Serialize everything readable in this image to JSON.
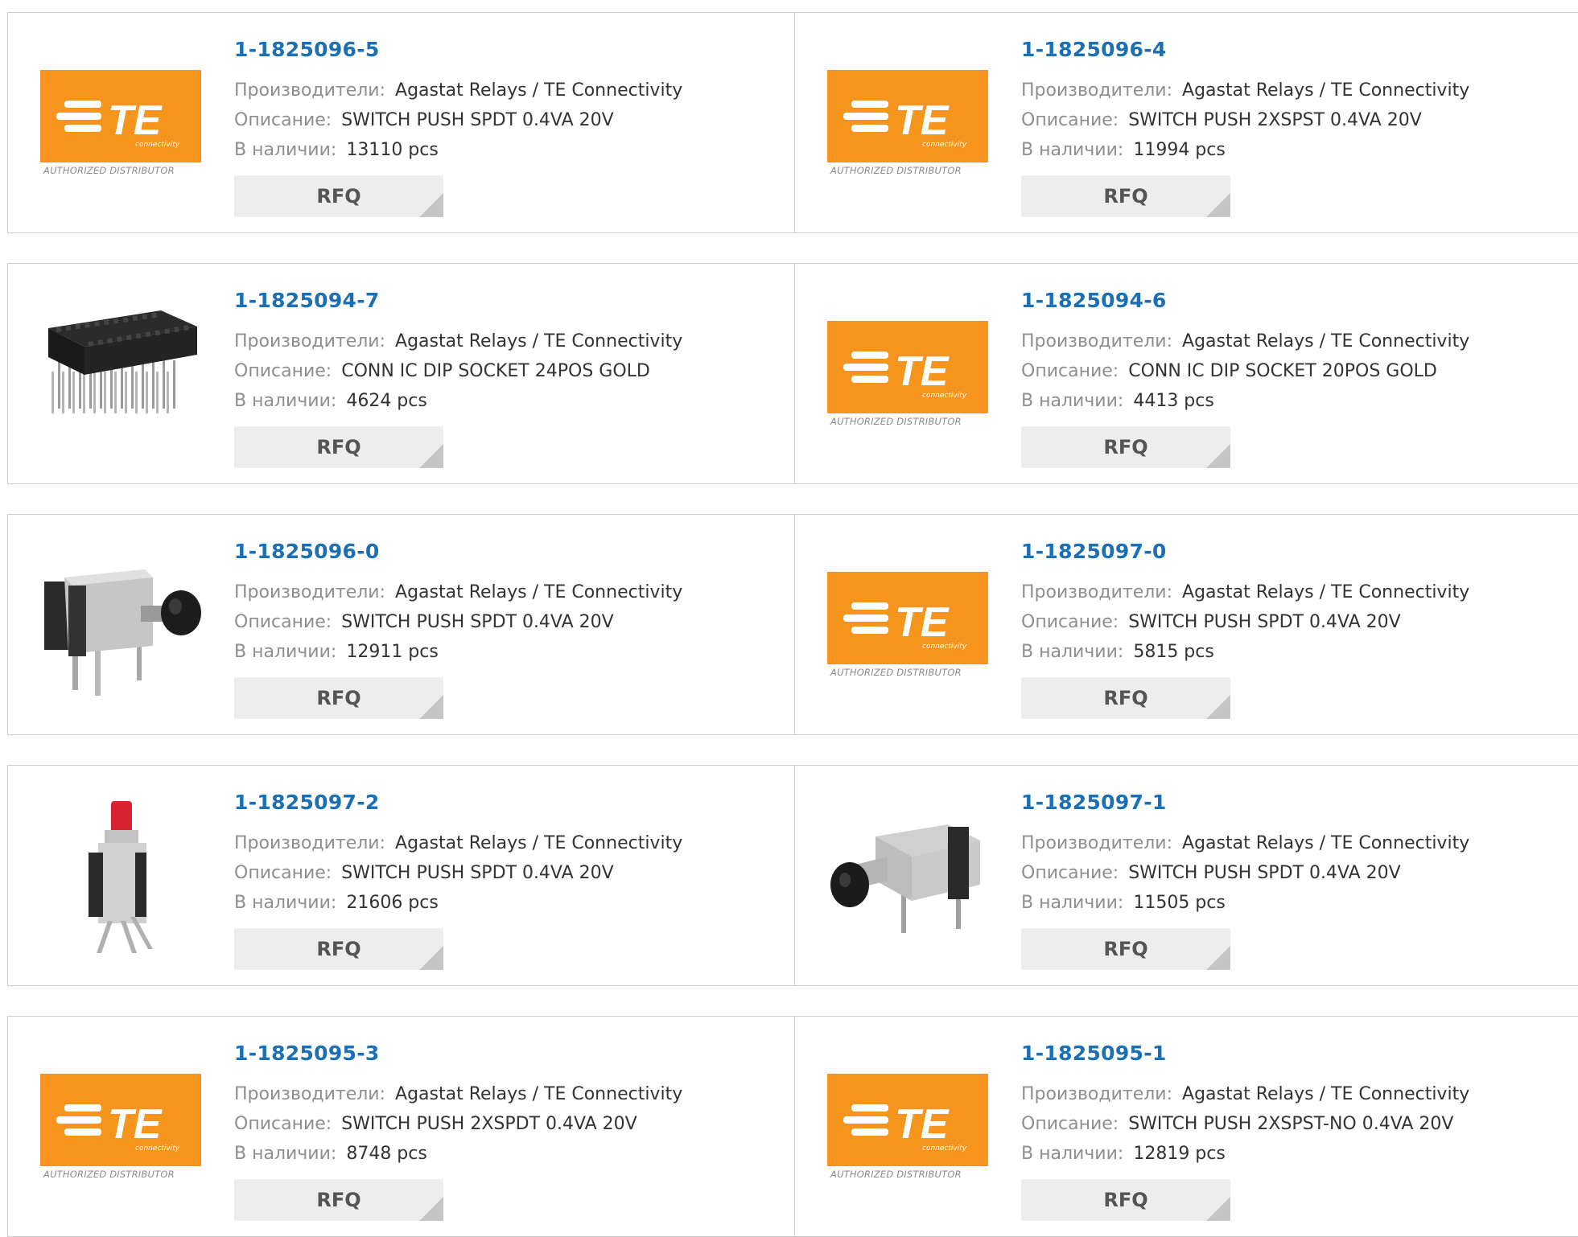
{
  "labels": {
    "manufacturer": "Производители:",
    "description": "Описание:",
    "stock": "В наличии:",
    "rfq": "RFQ",
    "logo_brand": "TE",
    "logo_sub": "connectivity",
    "logo_tag": "AUTHORIZED DISTRIBUTOR"
  },
  "colors": {
    "accent": "#1a6fb5",
    "logo_orange": "#f7941d",
    "button_bg": "#ededed"
  },
  "products": [
    {
      "pn": "1-1825096-5",
      "manufacturer": "Agastat Relays / TE Connectivity",
      "description": "SWITCH PUSH SPDT 0.4VA 20V",
      "stock": "13110 pcs",
      "image": "te-logo"
    },
    {
      "pn": "1-1825096-4",
      "manufacturer": "Agastat Relays / TE Connectivity",
      "description": "SWITCH PUSH 2XSPST 0.4VA 20V",
      "stock": "11994 pcs",
      "image": "te-logo"
    },
    {
      "pn": "1-1825094-7",
      "manufacturer": "Agastat Relays / TE Connectivity",
      "description": "CONN IC DIP SOCKET 24POS GOLD",
      "stock": "4624 pcs",
      "image": "dip-socket"
    },
    {
      "pn": "1-1825094-6",
      "manufacturer": "Agastat Relays / TE Connectivity",
      "description": "CONN IC DIP SOCKET 20POS GOLD",
      "stock": "4413 pcs",
      "image": "te-logo"
    },
    {
      "pn": "1-1825096-0",
      "manufacturer": "Agastat Relays / TE Connectivity",
      "description": "SWITCH PUSH SPDT 0.4VA 20V",
      "stock": "12911 pcs",
      "image": "push-switch-right-angle"
    },
    {
      "pn": "1-1825097-0",
      "manufacturer": "Agastat Relays / TE Connectivity",
      "description": "SWITCH PUSH SPDT 0.4VA 20V",
      "stock": "5815 pcs",
      "image": "te-logo"
    },
    {
      "pn": "1-1825097-2",
      "manufacturer": "Agastat Relays / TE Connectivity",
      "description": "SWITCH PUSH SPDT 0.4VA 20V",
      "stock": "21606 pcs",
      "image": "push-switch-red"
    },
    {
      "pn": "1-1825097-1",
      "manufacturer": "Agastat Relays / TE Connectivity",
      "description": "SWITCH PUSH SPDT 0.4VA 20V",
      "stock": "11505 pcs",
      "image": "push-switch-black"
    },
    {
      "pn": "1-1825095-3",
      "manufacturer": "Agastat Relays / TE Connectivity",
      "description": "SWITCH PUSH 2XSPDT 0.4VA 20V",
      "stock": "8748 pcs",
      "image": "te-logo"
    },
    {
      "pn": "1-1825095-1",
      "manufacturer": "Agastat Relays / TE Connectivity",
      "description": "SWITCH PUSH 2XSPST-NO 0.4VA 20V",
      "stock": "12819 pcs",
      "image": "te-logo"
    }
  ]
}
